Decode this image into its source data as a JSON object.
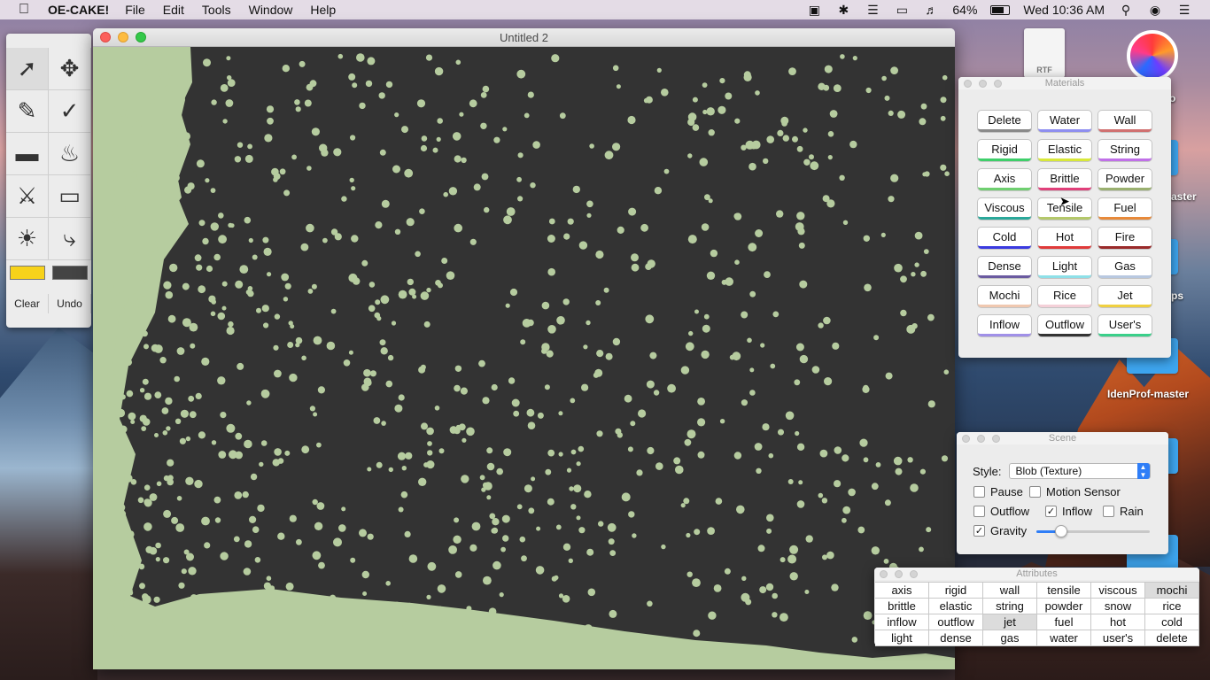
{
  "menubar": {
    "app_name": "OE-CAKE!",
    "menus": [
      "File",
      "Edit",
      "Tools",
      "Window",
      "Help"
    ],
    "battery": "64%",
    "clock": "Wed 10:36 AM"
  },
  "desktop": {
    "doc_icon_label": "RTF",
    "labels": [
      "o",
      "aster",
      "ps",
      "IdenProf-master"
    ]
  },
  "tool_palette": {
    "tools": [
      "arrow-icon",
      "move-icon",
      "pencil-icon",
      "brush-icon",
      "rectangle-icon",
      "bucket-icon",
      "knife-icon",
      "eraser-icon",
      "flashlight-icon",
      "dropper-icon"
    ],
    "swatch_colors": [
      "#f7d21a",
      "#444444"
    ],
    "clear_label": "Clear",
    "undo_label": "Undo"
  },
  "main_window": {
    "title": "Untitled 2",
    "fluid_color": "#b6cc9f",
    "background_color": "#333333"
  },
  "materials": {
    "title": "Materials",
    "buttons": [
      {
        "label": "Delete",
        "color": "#8a8a8a"
      },
      {
        "label": "Water",
        "color": "#8e8ef0"
      },
      {
        "label": "Wall",
        "color": "#d07070"
      },
      {
        "label": "Rigid",
        "color": "#3ecf6a"
      },
      {
        "label": "Elastic",
        "color": "#d8e83a"
      },
      {
        "label": "String",
        "color": "#c070e8"
      },
      {
        "label": "Axis",
        "color": "#6fcf70"
      },
      {
        "label": "Brittle",
        "color": "#e0407a"
      },
      {
        "label": "Powder",
        "color": "#9ab070"
      },
      {
        "label": "Viscous",
        "color": "#2aa89a"
      },
      {
        "label": "Tensile",
        "color": "#b4c86a"
      },
      {
        "label": "Fuel",
        "color": "#e88a3a"
      },
      {
        "label": "Cold",
        "color": "#3a3ae0"
      },
      {
        "label": "Hot",
        "color": "#e03a3a"
      },
      {
        "label": "Fire",
        "color": "#9a2a2a"
      },
      {
        "label": "Dense",
        "color": "#6a5aa0"
      },
      {
        "label": "Light",
        "color": "#8ee0e8"
      },
      {
        "label": "Gas",
        "color": "#b8c8e0"
      },
      {
        "label": "Mochi",
        "color": "#f0c8b0"
      },
      {
        "label": "Rice",
        "color": "#f4d0d8"
      },
      {
        "label": "Jet",
        "color": "#f0d040"
      },
      {
        "label": "Inflow",
        "color": "#a090e8"
      },
      {
        "label": "Outflow",
        "color": "#333333"
      },
      {
        "label": "User's",
        "color": "#3ad08a"
      }
    ]
  },
  "scene": {
    "title": "Scene",
    "style_label": "Style:",
    "style_value": "Blob (Texture)",
    "options": {
      "pause": {
        "label": "Pause",
        "checked": false
      },
      "motion_sensor": {
        "label": "Motion Sensor",
        "checked": false
      },
      "outflow": {
        "label": "Outflow",
        "checked": false
      },
      "inflow": {
        "label": "Inflow",
        "checked": true
      },
      "rain": {
        "label": "Rain",
        "checked": false
      },
      "gravity": {
        "label": "Gravity",
        "checked": true
      }
    },
    "gravity_level": 0.22
  },
  "attributes": {
    "title": "Attributes",
    "cells": [
      "axis",
      "rigid",
      "wall",
      "tensile",
      "viscous",
      "mochi",
      "brittle",
      "elastic",
      "string",
      "powder",
      "snow",
      "rice",
      "inflow",
      "outflow",
      "jet",
      "fuel",
      "hot",
      "cold",
      "light",
      "dense",
      "gas",
      "water",
      "user's",
      "delete"
    ],
    "selected": [
      "mochi",
      "jet"
    ]
  }
}
